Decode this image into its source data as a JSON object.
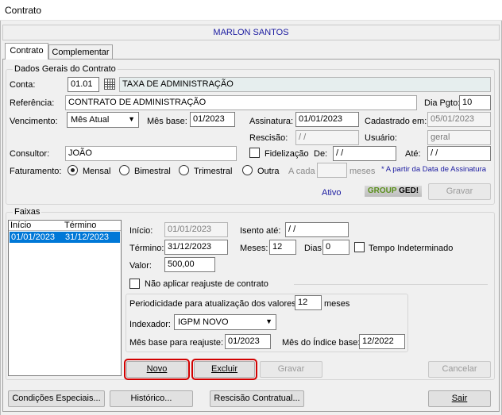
{
  "window": {
    "title": "Contrato"
  },
  "header": {
    "name": "MARLON SANTOS"
  },
  "tabs": [
    {
      "label": "Contrato"
    },
    {
      "label": "Complementar"
    }
  ],
  "dados": {
    "legend": "Dados Gerais do Contrato",
    "conta_label": "Conta:",
    "conta_code": "01.01",
    "conta_desc": "TAXA DE ADMINISTRAÇÃO",
    "referencia_label": "Referência:",
    "referencia": "CONTRATO DE ADMINISTRAÇÃO",
    "dia_pgto_label": "Dia Pgto:",
    "dia_pgto": "10",
    "vencimento_label": "Vencimento:",
    "vencimento": "Mês Atual",
    "mes_base_label": "Mês base:",
    "mes_base": "01/2023",
    "assinatura_label": "Assinatura:",
    "assinatura": "01/01/2023",
    "cadastrado_label": "Cadastrado em:",
    "cadastrado": "05/01/2023",
    "rescisao_label": "Rescisão:",
    "rescisao": " /  /",
    "usuario_label": "Usuário:",
    "usuario": "geral",
    "consultor_label": "Consultor:",
    "consultor": "JOÃO",
    "fidelizacao_label": "Fidelização",
    "de_label": "De:",
    "de": " /  /",
    "ate_label": "Até:",
    "ate": " /  /",
    "faturamento_label": "Faturamento:",
    "opt_mensal": "Mensal",
    "opt_bimestral": "Bimestral",
    "opt_trimestral": "Trimestral",
    "opt_outra": "Outra",
    "a_cada_label": "A cada",
    "meses_label": "meses",
    "assinatura_note": "* A partir da Data de Assinatura",
    "status": "Ativo",
    "logo": "GROUP GED!",
    "gravar_label": "Gravar"
  },
  "faixas": {
    "legend": "Faixas",
    "col_inicio": "Início",
    "col_termino": "Término",
    "row_inicio": "01/01/2023",
    "row_termino": "31/12/2023",
    "inicio_label": "Início:",
    "inicio": "01/01/2023",
    "isento_label": "Isento até:",
    "isento": " /  /",
    "termino_label": "Término:",
    "termino": "31/12/2023",
    "meses_label": "Meses:",
    "meses": "12",
    "dias_label": "Dias:",
    "dias": "0",
    "tempo_label": "Tempo Indeterminado",
    "valor_label": "Valor:",
    "valor": "500,00",
    "nao_aplicar_label": "Não aplicar reajuste de contrato",
    "periodicidade_label": "Periodicidade para atualização dos valores:",
    "periodicidade": "12",
    "periodicidade_unit": "meses",
    "indexador_label": "Indexador:",
    "indexador": "IGPM NOVO",
    "mes_base_reajuste_label": "Mês base para reajuste:",
    "mes_base_reajuste": "01/2023",
    "mes_indice_label": "Mês do Índice base:",
    "mes_indice": "12/2022",
    "novo": "Novo",
    "excluir": "Excluir",
    "gravar": "Gravar",
    "cancelar": "Cancelar"
  },
  "footer": {
    "condicoes": "Condições Especiais...",
    "historico": "Histórico...",
    "rescisao": "Rescisão Contratual...",
    "sair": "Sair"
  },
  "colors": {
    "name_text": "#1a1aa0",
    "highlight": "#d10000",
    "selection": "#0078d7",
    "note": "#1a1aa0"
  }
}
